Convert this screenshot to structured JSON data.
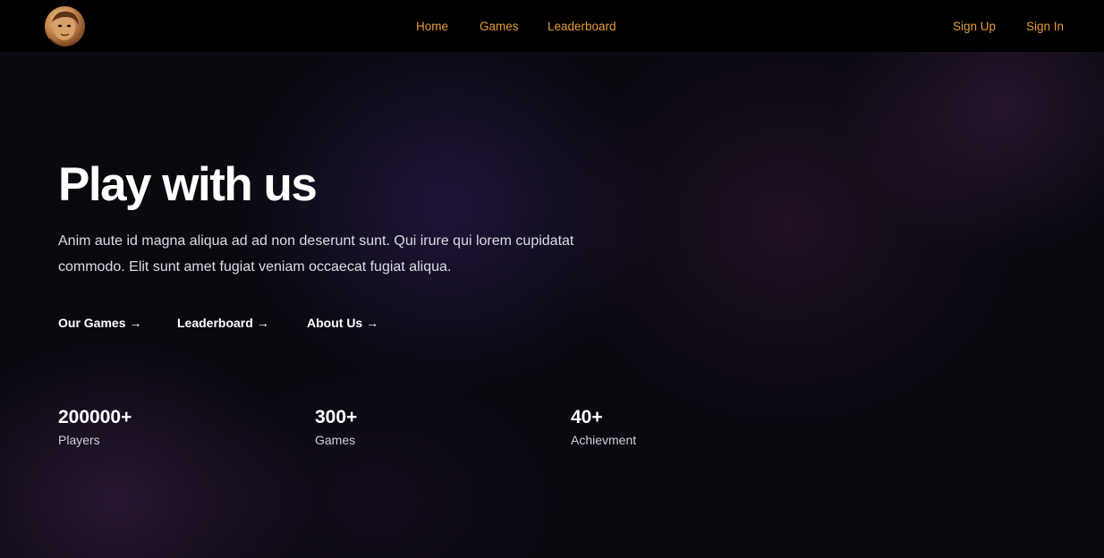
{
  "nav": {
    "logo_icon": "warrior-avatar-logo",
    "links": [
      {
        "label": "Home"
      },
      {
        "label": "Games"
      },
      {
        "label": "Leaderboard"
      }
    ],
    "auth": {
      "sign_up": "Sign Up",
      "sign_in": "Sign In"
    },
    "link_color": "#e89a38"
  },
  "hero": {
    "title": "Play with us",
    "description": "Anim aute id magna aliqua ad ad non deserunt sunt. Qui irure qui lorem cupidatat commodo. Elit sunt amet fugiat veniam occaecat fugiat aliqua.",
    "links": [
      {
        "label": "Our Games →"
      },
      {
        "label": "Leaderboard →"
      },
      {
        "label": "About Us →"
      }
    ]
  },
  "stats": [
    {
      "value": "200000+",
      "label": "Players"
    },
    {
      "value": "300+",
      "label": "Games"
    },
    {
      "value": "40+",
      "label": "Achievment"
    }
  ],
  "colors": {
    "background": "#0a0910",
    "navbar": "#000000",
    "accent": "#e89a38",
    "text": "#ffffff"
  }
}
